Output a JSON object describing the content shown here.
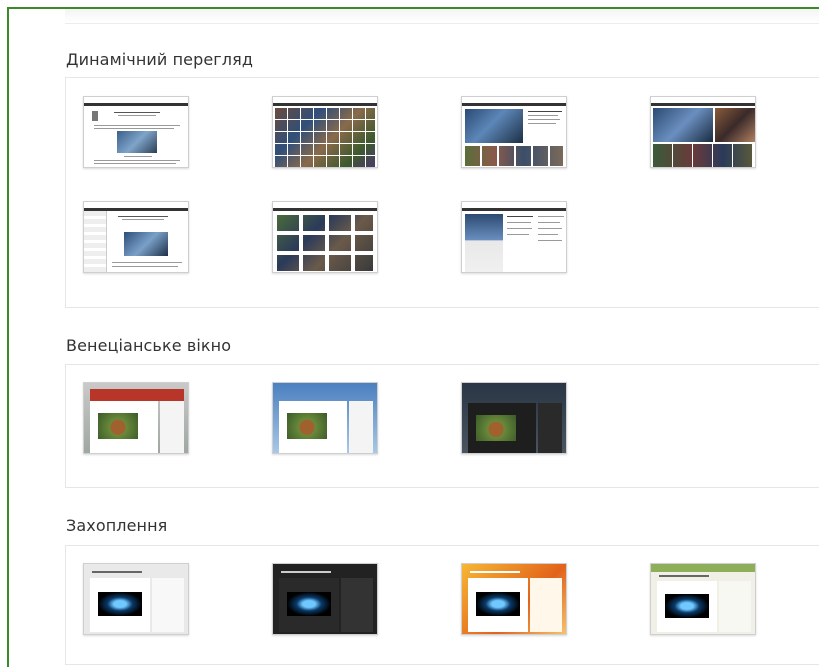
{
  "sections": [
    {
      "title": "Динамічний перегляд",
      "templates": [
        "dynamic-classic",
        "dynamic-flipcard",
        "dynamic-magazine",
        "dynamic-mosaic",
        "dynamic-sidebar",
        "dynamic-snapshot",
        "dynamic-timeslide"
      ]
    },
    {
      "title": "Венеціанське вікно",
      "templates": [
        "picture-window-red",
        "picture-window-sky",
        "picture-window-dark"
      ]
    },
    {
      "title": "Захоплення",
      "templates": [
        "awesome-light",
        "awesome-dark",
        "awesome-orange",
        "awesome-green"
      ]
    }
  ],
  "colors": {
    "frame": "#3a8a2a",
    "panel_border": "#e6e6e6",
    "title": "#333333"
  }
}
